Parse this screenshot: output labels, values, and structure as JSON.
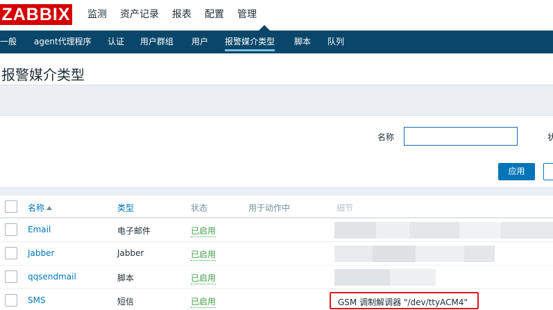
{
  "header": {
    "logo": "ZABBIX",
    "menu": [
      "监测",
      "资产记录",
      "报表",
      "配置",
      "管理"
    ]
  },
  "subnav": {
    "items": [
      "一般",
      "agent代理程序",
      "认证",
      "用户群组",
      "用户",
      "报警媒介类型",
      "脚本",
      "队列"
    ],
    "active": "报警媒介类型"
  },
  "page": {
    "title": "报警媒介类型"
  },
  "filter": {
    "name_label": "名称",
    "name_value": "",
    "status_label": "状",
    "apply_label": "应用"
  },
  "table": {
    "columns": [
      "名称",
      "类型",
      "状态",
      "用于动作中",
      "细节"
    ],
    "rows": [
      {
        "name": "Email",
        "type": "电子邮件",
        "status": "已启用",
        "details": ""
      },
      {
        "name": "Jabber",
        "type": "Jabber",
        "status": "已启用",
        "details": ""
      },
      {
        "name": "qqsendmail",
        "type": "脚本",
        "status": "已启用",
        "details": ""
      },
      {
        "name": "SMS",
        "type": "短信",
        "status": "已启用",
        "details": "GSM 调制解调器 \"/dev/ttyACM4\""
      }
    ]
  },
  "colors": {
    "logo_red": "#d40000",
    "nav_blue": "#0a466a",
    "link_blue": "#0275b8",
    "status_green": "#429e47",
    "highlight_red": "#e0141e"
  }
}
